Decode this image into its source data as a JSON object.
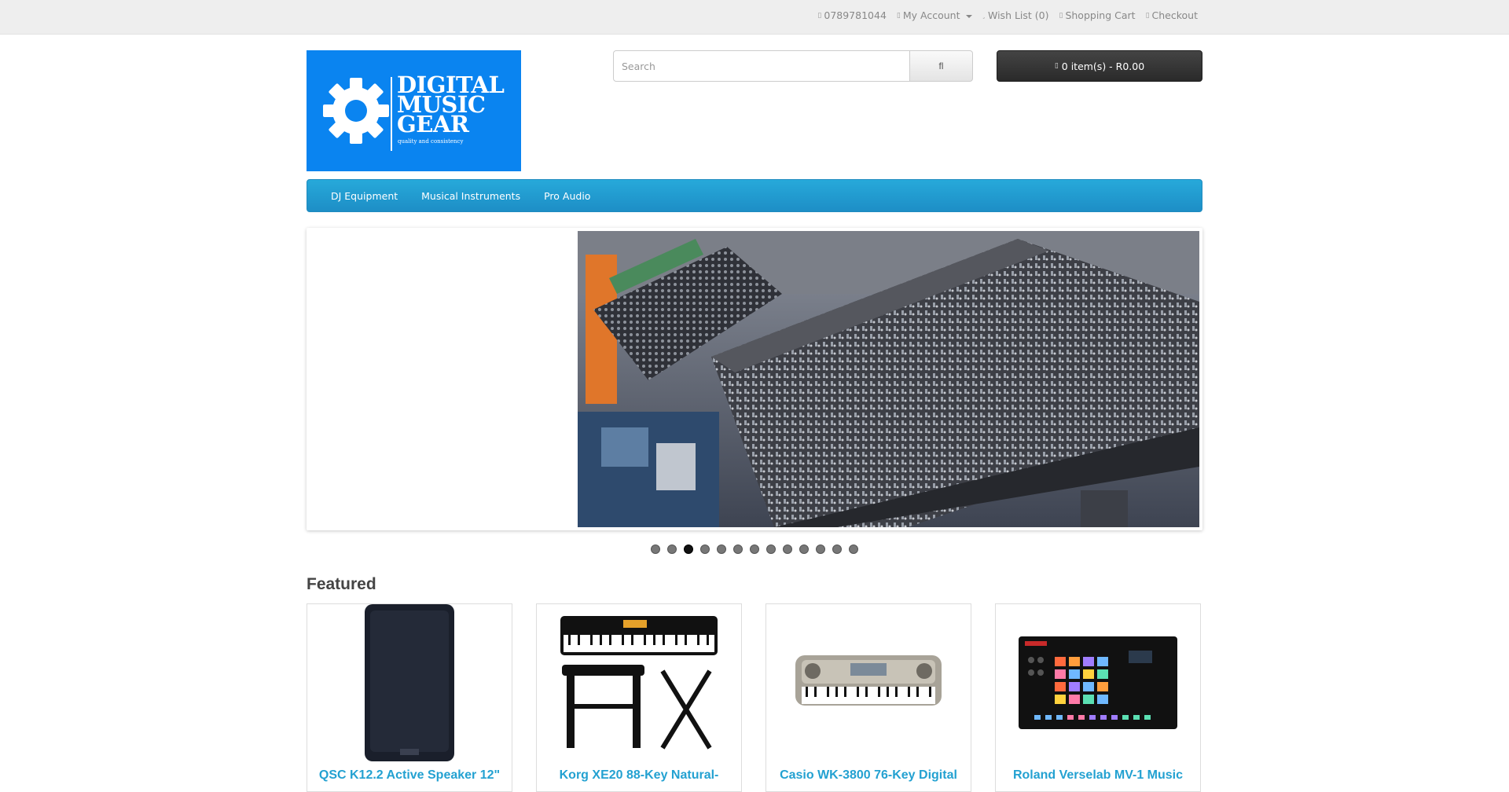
{
  "topbar": {
    "phone": "0789781044",
    "my_account": "My Account",
    "wishlist": "Wish List (0)",
    "shopping_cart": "Shopping Cart",
    "checkout": "Checkout"
  },
  "logo": {
    "line1": "DIGITAL",
    "line2": "MUSIC",
    "line3": "GEAR",
    "tagline": "quality and consistency"
  },
  "search": {
    "placeholder": "Search"
  },
  "cart": {
    "label": "0 item(s) - R0.00"
  },
  "menu": {
    "items": [
      {
        "label": "DJ Equipment"
      },
      {
        "label": "Musical Instruments"
      },
      {
        "label": "Pro Audio"
      }
    ]
  },
  "slideshow": {
    "slide_count": 13,
    "active_index": 2
  },
  "featured": {
    "title": "Featured",
    "products": [
      {
        "name": "QSC K12.2 Active Speaker 12\""
      },
      {
        "name": "Korg XE20 88-Key Natural-"
      },
      {
        "name": "Casio WK-3800 76-Key Digital"
      },
      {
        "name": "Roland Verselab MV-1 Music"
      }
    ]
  },
  "colors": {
    "brand_blue": "#0a84f0",
    "menu_blue": "#229ccf",
    "link_blue": "#23a1d1",
    "cart_dark": "#333333"
  }
}
